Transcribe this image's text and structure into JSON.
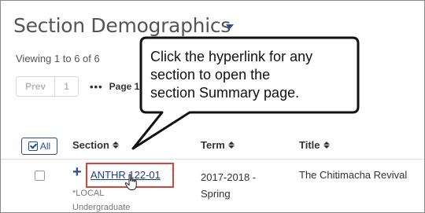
{
  "page": {
    "title": "Section Demographics",
    "viewing": "Viewing 1 to 6 of 6"
  },
  "pager": {
    "prev": "Prev",
    "current": "1",
    "dots": "•••",
    "page_label": "Page 1"
  },
  "table": {
    "select_all": "All",
    "headers": {
      "section": "Section",
      "term": "Term",
      "title": "Title"
    },
    "rows": [
      {
        "section_link": "ANTHR 122-01",
        "local": "*LOCAL",
        "level": "Undergraduate",
        "term_line1": "2017-2018 -",
        "term_line2": "Spring",
        "title": "The Chitimacha Revival"
      }
    ]
  },
  "callout": {
    "line1": "Click the hyperlink for any",
    "line2": "section to open the",
    "line3": "section Summary page."
  },
  "colors": {
    "accent": "#2a4d8f",
    "highlight": "#d8443c"
  },
  "icons": [
    "caret-down-icon",
    "check-square-icon",
    "sort-icon",
    "plus-icon",
    "hand-pointer-icon"
  ]
}
